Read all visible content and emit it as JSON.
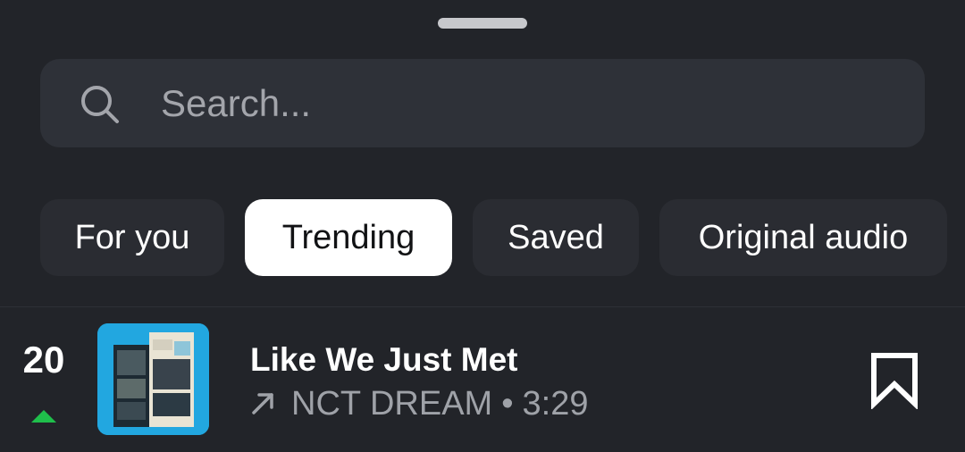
{
  "search": {
    "placeholder": "Search...",
    "icon": "search-icon"
  },
  "tabs": [
    {
      "label": "For you",
      "active": false
    },
    {
      "label": "Trending",
      "active": true
    },
    {
      "label": "Saved",
      "active": false
    },
    {
      "label": "Original audio",
      "active": false
    }
  ],
  "track": {
    "rank": "20",
    "rank_trend": "up",
    "rank_trend_color": "#1fbf4b",
    "title": "Like We Just Met",
    "artist": "NCT DREAM",
    "separator": "•",
    "duration": "3:29",
    "album_art_color": "#22a7e0",
    "saved": false
  },
  "colors": {
    "background": "#222429",
    "surface": "#2e3138",
    "chip": "#2a2c32",
    "chip_active": "#ffffff",
    "muted_text": "#9fa2a8"
  }
}
